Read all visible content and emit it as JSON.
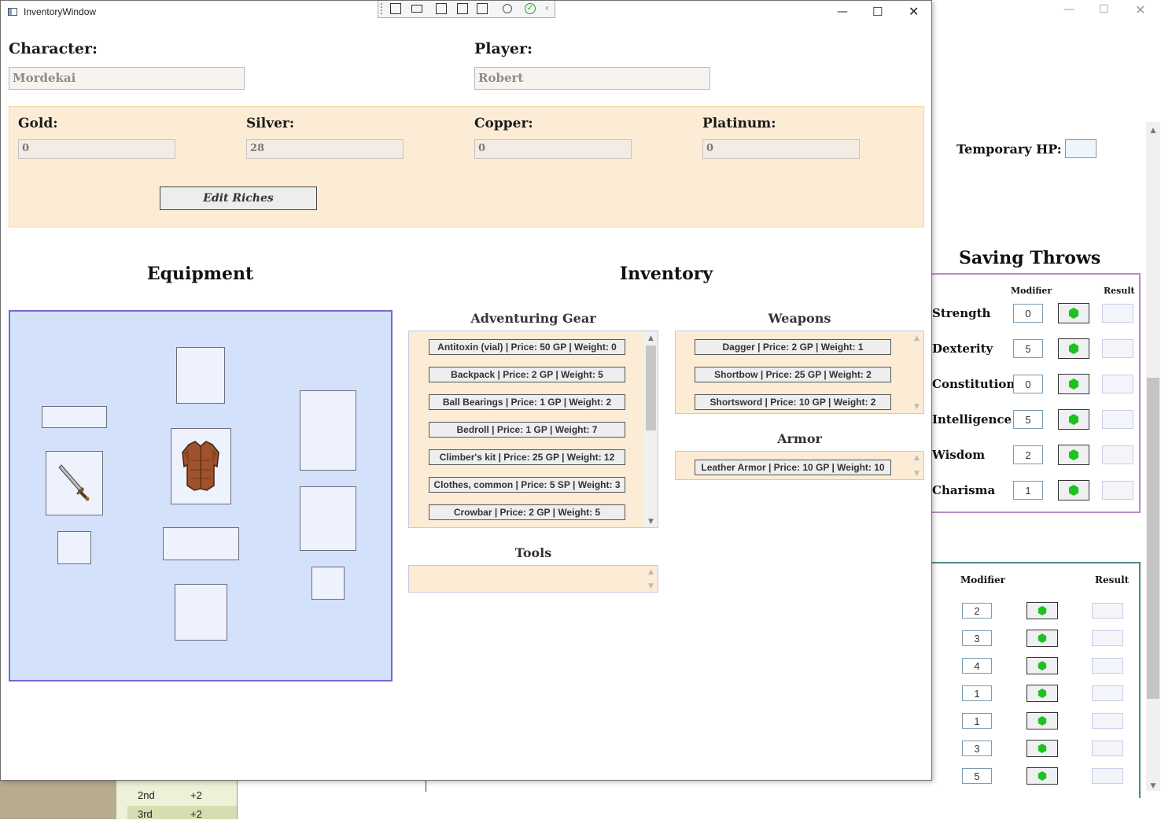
{
  "background_window": {
    "temp_hp_label": "Temporary HP:",
    "saving_throws": {
      "title": "Saving Throws",
      "modifier_header": "Modifier",
      "result_header": "Result",
      "rows": [
        {
          "label": "Strength",
          "modifier": "0"
        },
        {
          "label": "Dexterity",
          "modifier": "5"
        },
        {
          "label": "Constitution",
          "modifier": "0"
        },
        {
          "label": "Intelligence",
          "modifier": "5"
        },
        {
          "label": "Wisdom",
          "modifier": "2"
        },
        {
          "label": "Charisma",
          "modifier": "1"
        }
      ]
    },
    "skills": {
      "modifier_header": "Modifier",
      "result_header": "Result",
      "modifiers": [
        "2",
        "3",
        "4",
        "1",
        "1",
        "3",
        "5"
      ]
    },
    "bottom_table": [
      {
        "level": "2nd",
        "bonus": "+2"
      },
      {
        "level": "3rd",
        "bonus": "+2"
      }
    ]
  },
  "window": {
    "title": "InventoryWindow"
  },
  "character": {
    "character_label": "Character:",
    "character_value": "Mordekai",
    "player_label": "Player:",
    "player_value": "Robert"
  },
  "riches": {
    "gold_label": "Gold:",
    "gold_value": "0",
    "silver_label": "Silver:",
    "silver_value": "28",
    "copper_label": "Copper:",
    "copper_value": "0",
    "platinum_label": "Platinum:",
    "platinum_value": "0",
    "edit_button": "Edit Riches"
  },
  "equipment": {
    "title": "Equipment"
  },
  "inventory": {
    "title": "Inventory",
    "adventuring_gear": {
      "title": "Adventuring Gear",
      "items": [
        "Antitoxin (vial) | Price: 50 GP | Weight: 0",
        "Backpack | Price: 2 GP | Weight: 5",
        "Ball Bearings | Price: 1 GP | Weight: 2",
        "Bedroll | Price: 1 GP | Weight: 7",
        "Climber's kit | Price: 25 GP | Weight: 12",
        "Clothes, common | Price: 5 SP | Weight: 3",
        "Crowbar | Price: 2 GP | Weight: 5"
      ]
    },
    "weapons": {
      "title": "Weapons",
      "items": [
        "Dagger | Price: 2 GP | Weight: 1",
        "Shortbow | Price: 25 GP | Weight: 2",
        "Shortsword | Price: 10 GP | Weight: 2"
      ]
    },
    "armor": {
      "title": "Armor",
      "items": [
        "Leather Armor | Price: 10 GP | Weight: 10"
      ]
    },
    "tools": {
      "title": "Tools",
      "items": []
    }
  },
  "colors": {
    "riches_bg": "#fdecd5",
    "equipment_bg": "#d3e1fb",
    "equipment_border": "#7a67cc",
    "saving_throw_border": "#b98bc4",
    "skills_border": "#4b8b85",
    "dice": "#1ec21e"
  }
}
